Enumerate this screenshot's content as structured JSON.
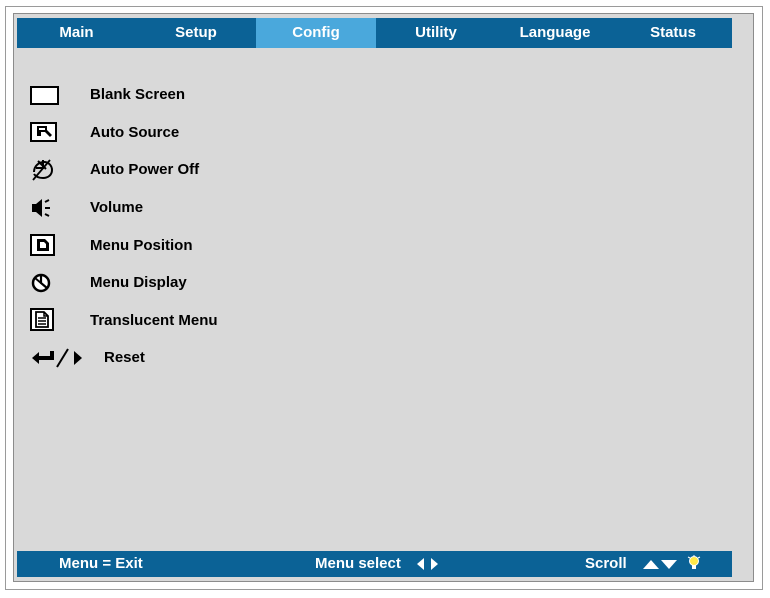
{
  "tabs": [
    {
      "label": "Main",
      "active": false
    },
    {
      "label": "Setup",
      "active": false
    },
    {
      "label": "Config",
      "active": true
    },
    {
      "label": "Utility",
      "active": false
    },
    {
      "label": "Language",
      "active": false
    },
    {
      "label": "Status",
      "active": false
    }
  ],
  "items": [
    {
      "label": "Blank Screen",
      "icon": "blank-screen-icon"
    },
    {
      "label": "Auto Source",
      "icon": "auto-source-icon"
    },
    {
      "label": "Auto Power Off",
      "icon": "auto-power-off-icon"
    },
    {
      "label": "Volume",
      "icon": "volume-icon"
    },
    {
      "label": "Menu Position",
      "icon": "menu-position-icon"
    },
    {
      "label": "Menu Display",
      "icon": "menu-display-icon"
    },
    {
      "label": "Translucent Menu",
      "icon": "translucent-menu-icon"
    },
    {
      "label": "Reset",
      "icon": "enter-right-icon"
    }
  ],
  "statusbar": {
    "exit_label": "Menu = Exit",
    "select_label": "Menu select",
    "scroll_label": "Scroll"
  },
  "colors": {
    "tab_bar": "#0b6296",
    "active_tab": "#4aa8dc",
    "panel": "#d9d9d9"
  }
}
